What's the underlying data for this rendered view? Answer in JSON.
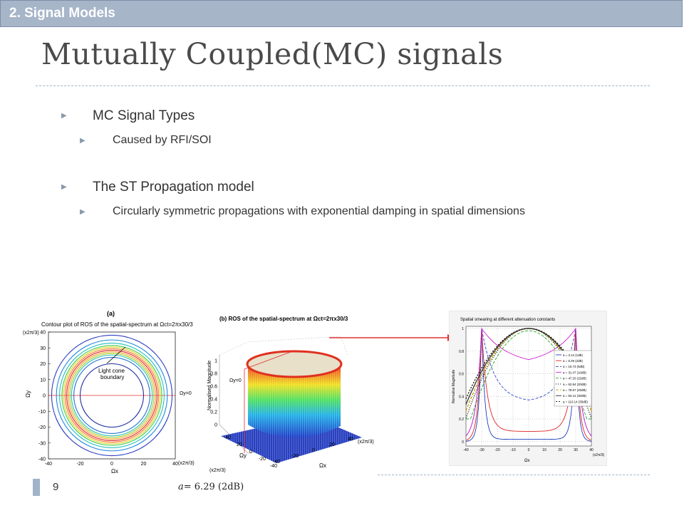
{
  "header": {
    "section_label": "2.   Signal Models"
  },
  "title": "Mutually Coupled(MC) signals",
  "bullets": [
    {
      "label": "MC Signal Types",
      "sub": [
        "Caused by  RFI/SOI"
      ]
    },
    {
      "label": "The ST Propagation model",
      "sub": [
        "Circularly symmetric propagations with exponential damping in spatial dimensions"
      ]
    }
  ],
  "figures": {
    "a": {
      "panel": "(a)",
      "title": "Contour plot of ROS of the spatial-spectrum at Ωct=2πx30/3",
      "annotation": "Light cone boundary",
      "annotation_line1": "Light cone",
      "annotation_line2": "boundary",
      "xlabel": "Ωx",
      "ylabel": "Ωy",
      "x_scale": "(x2π/3)",
      "y_scale": "(x2π/3)",
      "y0_label": "Ωy=0",
      "ticks": [
        -40,
        -30,
        -20,
        -10,
        0,
        10,
        20,
        30,
        40
      ],
      "xticks": [
        -40,
        -20,
        0,
        20,
        40
      ]
    },
    "b": {
      "title": "(b) ROS of the spatial-spectrum at Ωct=2πx30/3",
      "zlabel": "Normalised Magnitude",
      "zticks": [
        "0",
        "0.2",
        "0.4",
        "0.6",
        "0.8",
        "1"
      ],
      "xlabel": "Ωx",
      "ylabel": "Ωy",
      "y0_label": "Ωy=0",
      "x_scale": "(x2π/3)",
      "y_scale": "(x2π/3)",
      "x_ticks": [
        "-40",
        "-20",
        "0",
        "20",
        "40"
      ],
      "y_ticks": [
        "40",
        "20",
        "0",
        "-20",
        "-40"
      ]
    },
    "c": {
      "title": "Spatial smearing at different attenuation constants",
      "ylabel": "Normalise Magnitude",
      "xlabel": "Ωx",
      "x_scale": "(x2π/3)",
      "x_ticks": [
        "-40",
        "-30",
        "-20",
        "-10",
        "0",
        "10",
        "20",
        "30",
        "40"
      ],
      "y_ticks": [
        "0",
        "0.2",
        "0.4",
        "0.6",
        "0.8",
        "1"
      ],
      "legend": [
        {
          "label": "a = 3.14 (1dB)",
          "color": "#1f3fbf",
          "dash": ""
        },
        {
          "label": "a = 6.29 (2dB)",
          "color": "#e02020",
          "dash": ""
        },
        {
          "label": "a = 15.73 (5dB)",
          "color": "#3344cc",
          "dash": "4,2"
        },
        {
          "label": "a = 31.47 (10dB)",
          "color": "#cc22cc",
          "dash": ""
        },
        {
          "label": "a = 47.20 (15dB)",
          "color": "#22aa22",
          "dash": "4,2"
        },
        {
          "label": "a = 62.94 (20dB)",
          "color": "#000000",
          "dash": "1,2"
        },
        {
          "label": "a = 78.67 (25dB)",
          "color": "#c8a000",
          "dash": "4,2"
        },
        {
          "label": "a = 94.41 (30dB)",
          "color": "#333333",
          "dash": ""
        },
        {
          "label": "a = 110.14 (35dB)",
          "color": "#111111",
          "dash": "2,2"
        }
      ]
    }
  },
  "page_number": "9",
  "footnote": {
    "symbol": "a",
    "text": "= 6.29 (2dB)"
  },
  "colors": {
    "accent": "#a7b5c9",
    "rule": "#9fb4c9",
    "arrow": "#e03030"
  }
}
